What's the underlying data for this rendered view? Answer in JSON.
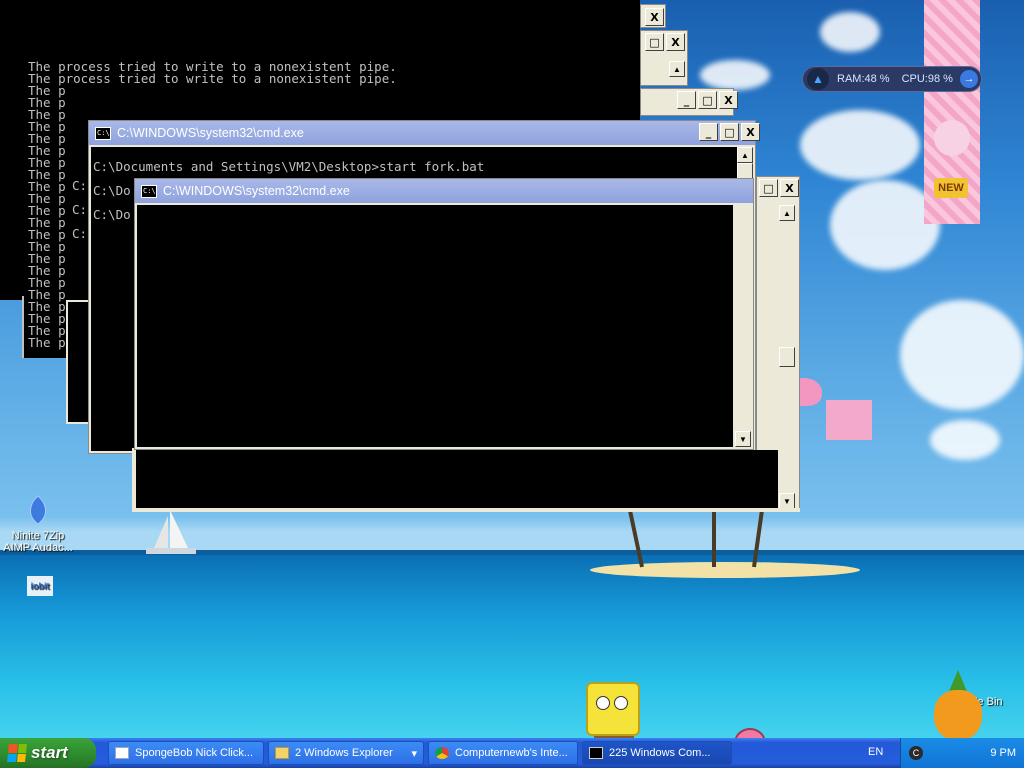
{
  "console_back": {
    "lines": [
      "The process tried to write to a nonexistent pipe.",
      "The process tried to write to a nonexistent pipe.",
      "The p",
      "The p",
      "The p",
      "The p",
      "The p",
      "The p",
      "The p",
      "The p",
      "The p",
      "The p",
      "The p",
      "The p",
      "The p",
      "The p",
      "The p",
      "The p",
      "The p",
      "The p",
      "The p",
      "The p",
      "The p",
      "The p"
    ],
    "fragments": [
      "C:",
      "C:",
      "C:"
    ]
  },
  "cmd_window_1": {
    "title": "C:\\WINDOWS\\system32\\cmd.exe",
    "lines": [
      "C:\\Documents and Settings\\VM2\\Desktop>start fork.bat",
      "C:\\Do",
      "C:\\Do"
    ]
  },
  "cmd_window_2": {
    "title": "C:\\WINDOWS\\system32\\cmd.exe"
  },
  "window_controls": {
    "minimize": "_",
    "maximize": "□",
    "close": "X"
  },
  "desktop_icons": [
    {
      "label": "Ninite 7Zip AIMP Audac...",
      "icon": "ninite-icon"
    },
    {
      "label": "",
      "icon": "iobit-icon"
    },
    {
      "label": "cle Bin",
      "icon": "recycle-bin-icon"
    }
  ],
  "gadget": {
    "ram": "RAM:48 %",
    "cpu": "CPU:98 %"
  },
  "taskbar": {
    "start_label": "start",
    "tasks": [
      {
        "label": "SpongeBob Nick Click...",
        "icon": "window-icon"
      },
      {
        "label": "2 Windows Explorer",
        "icon": "folder-icon",
        "dropdown": "▾"
      },
      {
        "label": "Computernewb's Inte...",
        "icon": "chrome-icon"
      },
      {
        "label": "225 Windows Com...",
        "icon": "cmd-icon"
      }
    ],
    "language": "EN",
    "clock": "9 PM"
  },
  "decor": {
    "badge": "NEW"
  }
}
